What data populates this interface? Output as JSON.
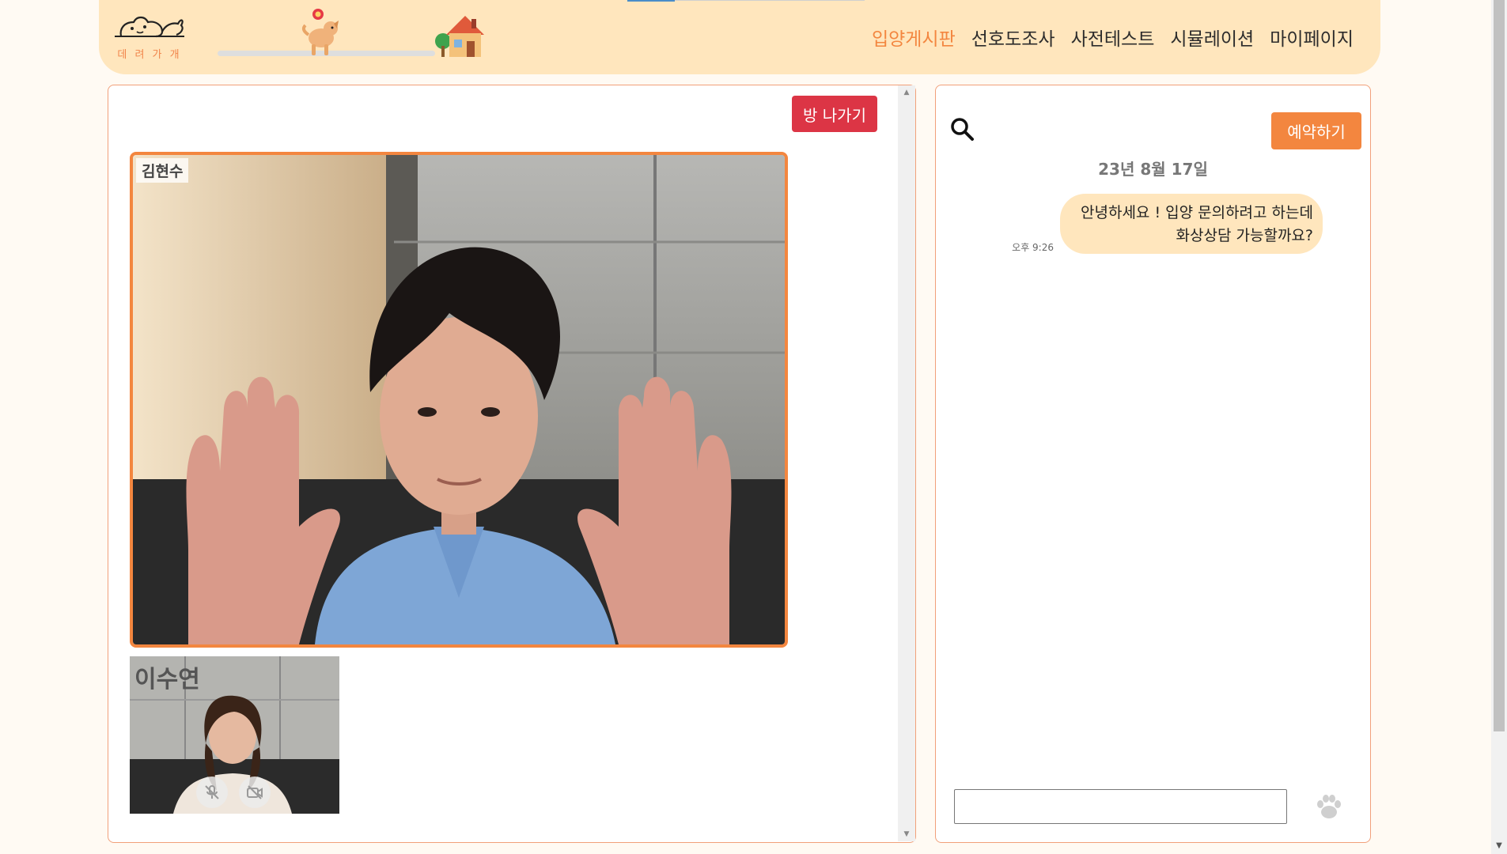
{
  "header": {
    "logo_text": "데 려 가 개",
    "nav": [
      {
        "label": "입양게시판",
        "active": true
      },
      {
        "label": "선호도조사",
        "active": false
      },
      {
        "label": "사전테스트",
        "active": false
      },
      {
        "label": "시뮬레이션",
        "active": false
      },
      {
        "label": "마이페이지",
        "active": false
      }
    ],
    "accent_color": "#f3863f",
    "background_color": "#ffe6bd"
  },
  "video": {
    "leave_button_label": "방 나가기",
    "leave_button_color": "#dc3545",
    "main_participant_name": "김현수",
    "sub_participant_name": "이수연",
    "sub_controls": [
      {
        "icon": "mic-off-icon",
        "state": "muted"
      },
      {
        "icon": "camera-off-icon",
        "state": "off"
      }
    ]
  },
  "chat": {
    "reserve_button_label": "예약하기",
    "date": "23년 8월 17일",
    "messages": [
      {
        "lines": [
          "안녕하세요 ! 입양 문의하려고 하는데",
          "화상상담 가능할까요?"
        ],
        "time": "오후 9:26",
        "sender": "self"
      }
    ],
    "input_value": "",
    "search_icon": "search-icon",
    "send_icon": "paw-icon"
  }
}
